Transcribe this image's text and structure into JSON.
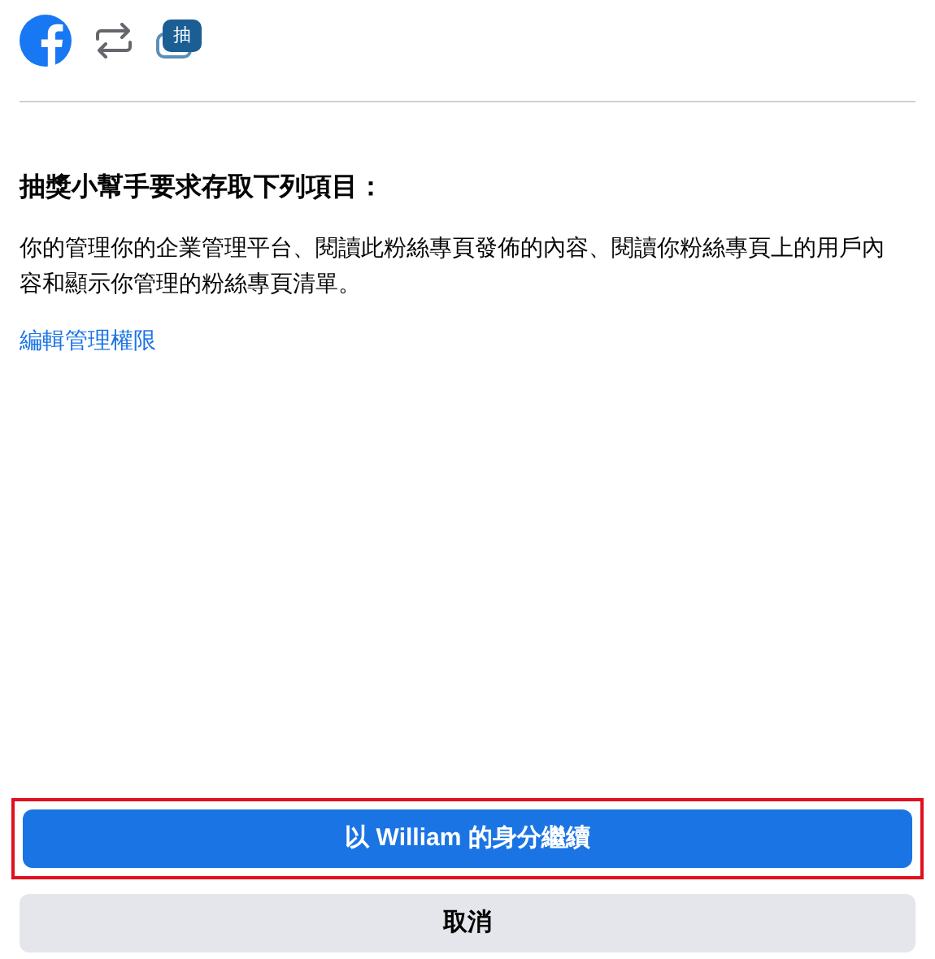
{
  "header": {
    "app_icon_label": "抽"
  },
  "title": "抽獎小幫手要求存取下列項目：",
  "description": "你的管理你的企業管理平台、閱讀此粉絲專頁發佈的內容、閱讀你粉絲專頁上的用戶內容和顯示你管理的粉絲專頁清單。",
  "link": "編輯管理權限",
  "buttons": [
    {
      "label": "以 William 的身分繼續",
      "kind": "primary",
      "highlighted": true
    },
    {
      "label": "取消",
      "kind": "secondary",
      "highlighted": false
    }
  ]
}
